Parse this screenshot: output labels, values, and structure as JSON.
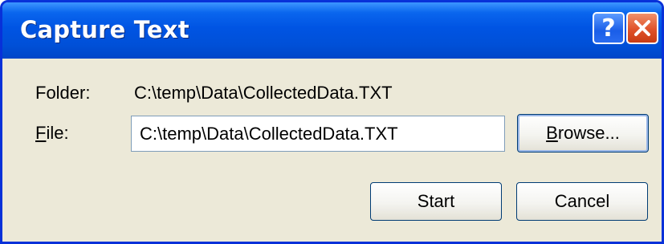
{
  "window": {
    "title": "Capture Text",
    "help_glyph": "?",
    "close_icon": "close-icon",
    "accent": "#0054e3"
  },
  "form": {
    "folder_label": "Folder:",
    "folder_value": "C:\\temp\\Data\\CollectedData.TXT",
    "file_label_mnemonic": "F",
    "file_label_rest": "ile:",
    "file_value": "C:\\temp\\Data\\CollectedData.TXT"
  },
  "buttons": {
    "browse_mnemonic": "B",
    "browse_rest": "rowse...",
    "start": "Start",
    "cancel": "Cancel"
  }
}
